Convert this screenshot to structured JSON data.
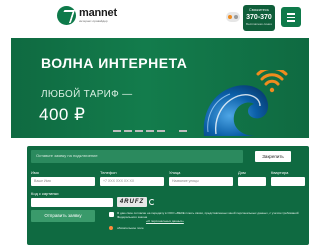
{
  "header": {
    "logo": {
      "name": "mannet",
      "tagline": "интернет-провайдер"
    },
    "contact": {
      "label": "Свяжитесь",
      "phone": "370-370",
      "sub": "Бесплатная линия"
    },
    "icons": [
      "globe-icon",
      "user-icon"
    ]
  },
  "banner": {
    "title": "ВОЛНА ИНТЕРНЕТА",
    "subtitle": "ЛЮБОЙ ТАРИФ —",
    "price": "400 ₽",
    "slide_count": 7,
    "active_slide": 6,
    "colors": {
      "bg": "#137c4c",
      "wave": "#0b5fa8",
      "wifi": "#f08c1e"
    }
  },
  "form": {
    "search_placeholder": "Оставьте заявку на подключение",
    "check_button": "Закрепить",
    "fields": [
      {
        "label": "Имя",
        "placeholder": "Ваше Имя"
      },
      {
        "label": "Телефон",
        "placeholder": "+7 XXX XXX XX XX"
      },
      {
        "label": "Улица",
        "placeholder": "Название улицы"
      },
      {
        "label": "Дом",
        "placeholder": ""
      },
      {
        "label": "Квартира",
        "placeholder": ""
      }
    ],
    "captcha_label": "Код с картинки",
    "captcha_text": "4RUFZ",
    "submit_button": "Отправить заявку",
    "consents": [
      "Я даю свое согласие на передачу в ООО «ВЕЗЕ плюс» связи, представленных мной персональных данных, с учетом требований Федерального закона",
      "обязательное поле"
    ],
    "consent_link": "«О персональных данных»"
  }
}
